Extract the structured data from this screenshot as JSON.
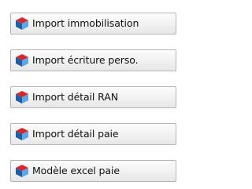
{
  "menu": {
    "items": [
      {
        "label": "Import immobilisation",
        "icon": "cube-icon"
      },
      {
        "label": "Import écriture perso.",
        "icon": "cube-icon"
      },
      {
        "label": "Import détail RAN",
        "icon": "cube-icon"
      },
      {
        "label": "Import détail paie",
        "icon": "cube-icon"
      },
      {
        "label": "Modèle excel paie",
        "icon": "cube-icon"
      }
    ]
  },
  "colors": {
    "cube_top": "#d9262a",
    "cube_left": "#1f5fa6",
    "cube_right": "#5ea7e6",
    "button_border": "#b5b5b5"
  }
}
